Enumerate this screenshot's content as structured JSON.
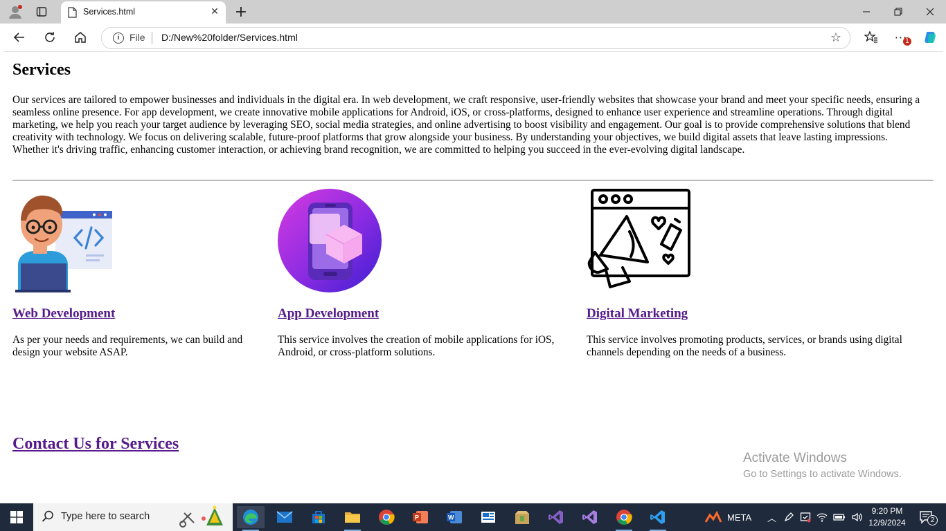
{
  "browser": {
    "tab_title": "Services.html",
    "new_tab_label": "+",
    "address": {
      "scheme_label": "File",
      "url": "D:/New%20folder/Services.html"
    },
    "notification_badge": "1"
  },
  "page": {
    "heading": "Services",
    "intro": "Our services are tailored to empower businesses and individuals in the digital era. In web development, we craft responsive, user-friendly websites that showcase your brand and meet your specific needs, ensuring a seamless online presence. For app development, we create innovative mobile applications for Android, iOS, or cross-platforms, designed to enhance user experience and streamline operations. Through digital marketing, we help you reach your target audience by leveraging SEO, social media strategies, and online advertising to boost visibility and engagement. Our goal is to provide comprehensive solutions that blend creativity with technology. We focus on delivering scalable, future-proof platforms that grow alongside your business. By understanding your objectives, we build digital assets that leave lasting impressions. Whether it's driving traffic, enhancing customer interaction, or achieving brand recognition, we are committed to helping you succeed in the ever-evolving digital landscape.",
    "services": [
      {
        "title": "Web Development",
        "description": "As per your needs and requirements, we can build and design your website ASAP."
      },
      {
        "title": "App Development",
        "description": "This service involves the creation of mobile applications for iOS, Android, or cross-platform solutions."
      },
      {
        "title": "Digital Marketing",
        "description": "This service involves promoting products, services, or brands using digital channels depending on the needs of a business."
      }
    ],
    "contact_link": "Contact Us for Services",
    "watermark": {
      "line1": "Activate Windows",
      "line2": "Go to Settings to activate Windows."
    }
  },
  "taskbar": {
    "search_placeholder": "Type here to search",
    "weather_label": "META",
    "time": "9:20 PM",
    "date": "12/9/2024",
    "notifications_count": "2"
  },
  "colors": {
    "link_visited": "#551a8b",
    "taskbar_bg": "#1f2a3c",
    "tabbar_bg": "#cfcfcf"
  }
}
